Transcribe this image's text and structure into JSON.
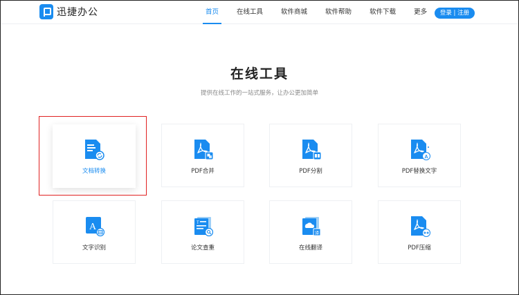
{
  "brand": {
    "name": "迅捷办公"
  },
  "nav": {
    "items": [
      {
        "label": "首页",
        "active": true
      },
      {
        "label": "在线工具"
      },
      {
        "label": "软件商城"
      },
      {
        "label": "软件帮助"
      },
      {
        "label": "软件下载"
      },
      {
        "label": "更多"
      }
    ],
    "login": "登录 | 注册"
  },
  "section": {
    "title": "在线工具",
    "subtitle": "提供在线工作的一站式服务，让办公更加简单"
  },
  "tools": [
    {
      "label": "文档转换",
      "icon": "doc-convert-icon"
    },
    {
      "label": "PDF合并",
      "icon": "pdf-merge-icon"
    },
    {
      "label": "PDF分割",
      "icon": "pdf-split-icon"
    },
    {
      "label": "PDF替换文字",
      "icon": "pdf-replace-text-icon"
    },
    {
      "label": "文字识别",
      "icon": "text-ocr-icon"
    },
    {
      "label": "论文查重",
      "icon": "paper-check-icon"
    },
    {
      "label": "在线翻译",
      "icon": "online-translate-icon"
    },
    {
      "label": "PDF压缩",
      "icon": "pdf-compress-icon"
    }
  ],
  "colors": {
    "accent": "#1a8cf0",
    "highlight": "#e02020"
  }
}
